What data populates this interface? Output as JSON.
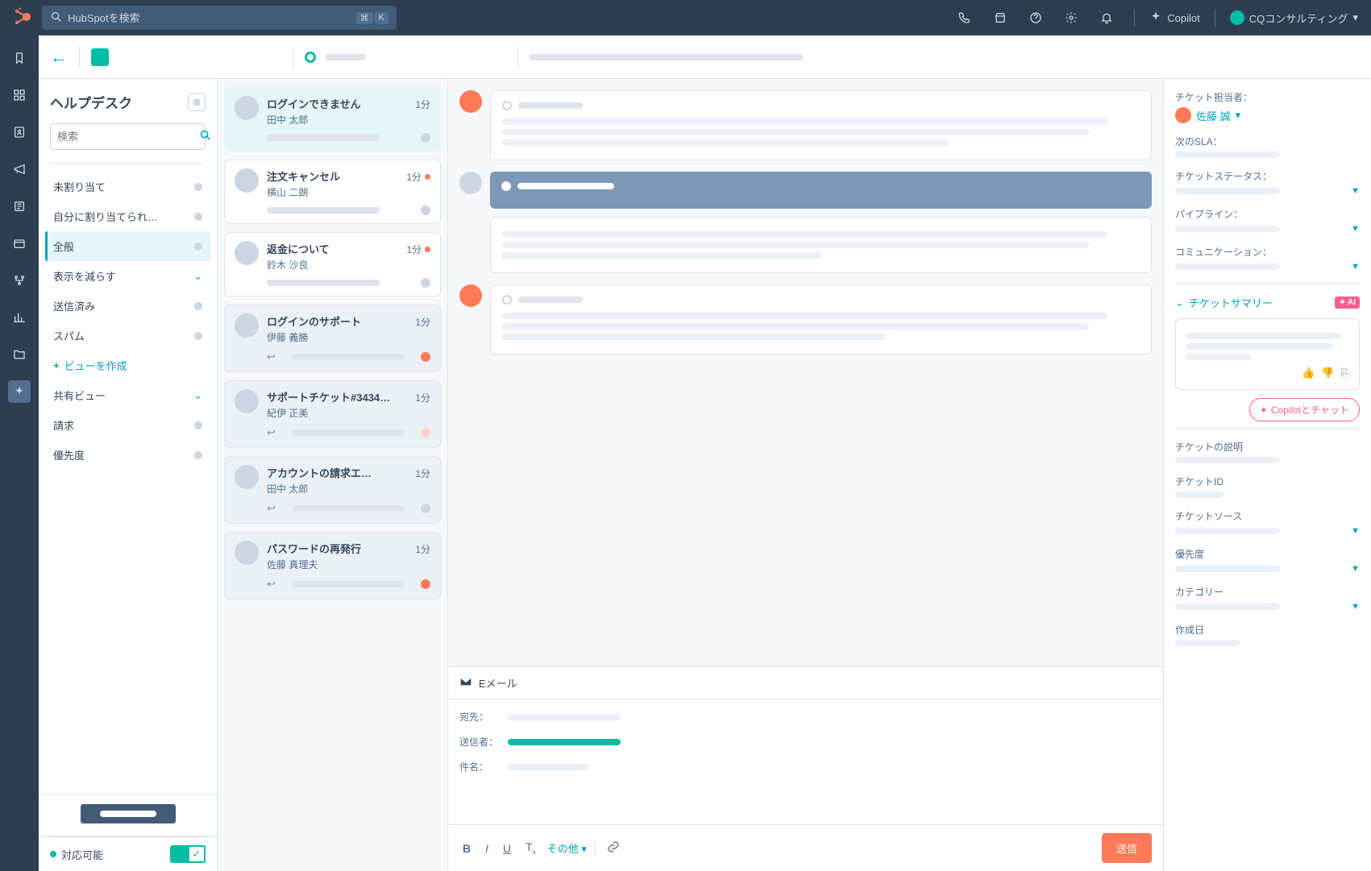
{
  "topbar": {
    "search_placeholder": "HubSpotを検索",
    "kbd1": "⌘",
    "kbd2": "K",
    "copilot": "Copilot",
    "account": "CQコンサルティング"
  },
  "sidebar": {
    "title": "ヘルプデスク",
    "search_placeholder": "検索",
    "items": [
      {
        "label": "未割り当て",
        "type": "dot"
      },
      {
        "label": "自分に割り当てられ…",
        "type": "dot"
      },
      {
        "label": "全般",
        "type": "dot",
        "active": true
      },
      {
        "label": "表示を減らす",
        "type": "chev"
      },
      {
        "label": "送信済み",
        "type": "dot"
      },
      {
        "label": "スパム",
        "type": "dot"
      },
      {
        "label": "ビューを作成",
        "type": "plus"
      },
      {
        "label": "共有ビュー",
        "type": "chev"
      },
      {
        "label": "請求",
        "type": "dot"
      },
      {
        "label": "優先度",
        "type": "dot"
      }
    ],
    "availability": "対応可能"
  },
  "tickets": [
    {
      "subject": "ログインできません",
      "name": "田中 太郎",
      "time": "1分",
      "selected": true,
      "orange": false,
      "status": "grey",
      "reply": false
    },
    {
      "subject": "注文キャンセル",
      "name": "横山 二朗",
      "time": "1分",
      "orange": true,
      "status": "grey",
      "reply": false
    },
    {
      "subject": "返金について",
      "name": "鈴木 沙良",
      "time": "1分",
      "orange": true,
      "status": "grey",
      "reply": false
    },
    {
      "subject": "ログインのサポート",
      "name": "伊藤 義勝",
      "time": "1分",
      "shaded": true,
      "orange": false,
      "status": "orange",
      "reply": true
    },
    {
      "subject": "サポートチケット#3434…",
      "name": "紀伊 正美",
      "time": "1分",
      "shaded": true,
      "orange": false,
      "status": "pale",
      "reply": true
    },
    {
      "subject": "アカウントの請求エ…",
      "name": "田中 太郎",
      "time": "1分",
      "shaded": true,
      "orange": false,
      "status": "grey",
      "reply": true
    },
    {
      "subject": "パスワードの再発行",
      "name": "佐藤 真理夫",
      "time": "1分",
      "shaded": true,
      "orange": false,
      "status": "orange",
      "reply": true
    }
  ],
  "composer": {
    "tab": "Eメール",
    "to": "宛先：",
    "from": "送信者：",
    "subject": "件名：",
    "more": "その他",
    "send": "送信"
  },
  "right": {
    "owner_label": "チケット担当者：",
    "owner_name": "佐藤 誠",
    "sla": "次のSLA：",
    "status": "チケットステータス：",
    "pipeline": "パイプライン：",
    "communication": "コミュニケーション：",
    "summary_title": "チケットサマリー",
    "ai_badge": "✦ AI",
    "copilot_chat": "Copilotとチャット",
    "desc": "チケットの説明",
    "ticket_id": "チケットID",
    "source": "チケットソース",
    "priority": "優先度",
    "category": "カテゴリー",
    "created": "作成日"
  }
}
